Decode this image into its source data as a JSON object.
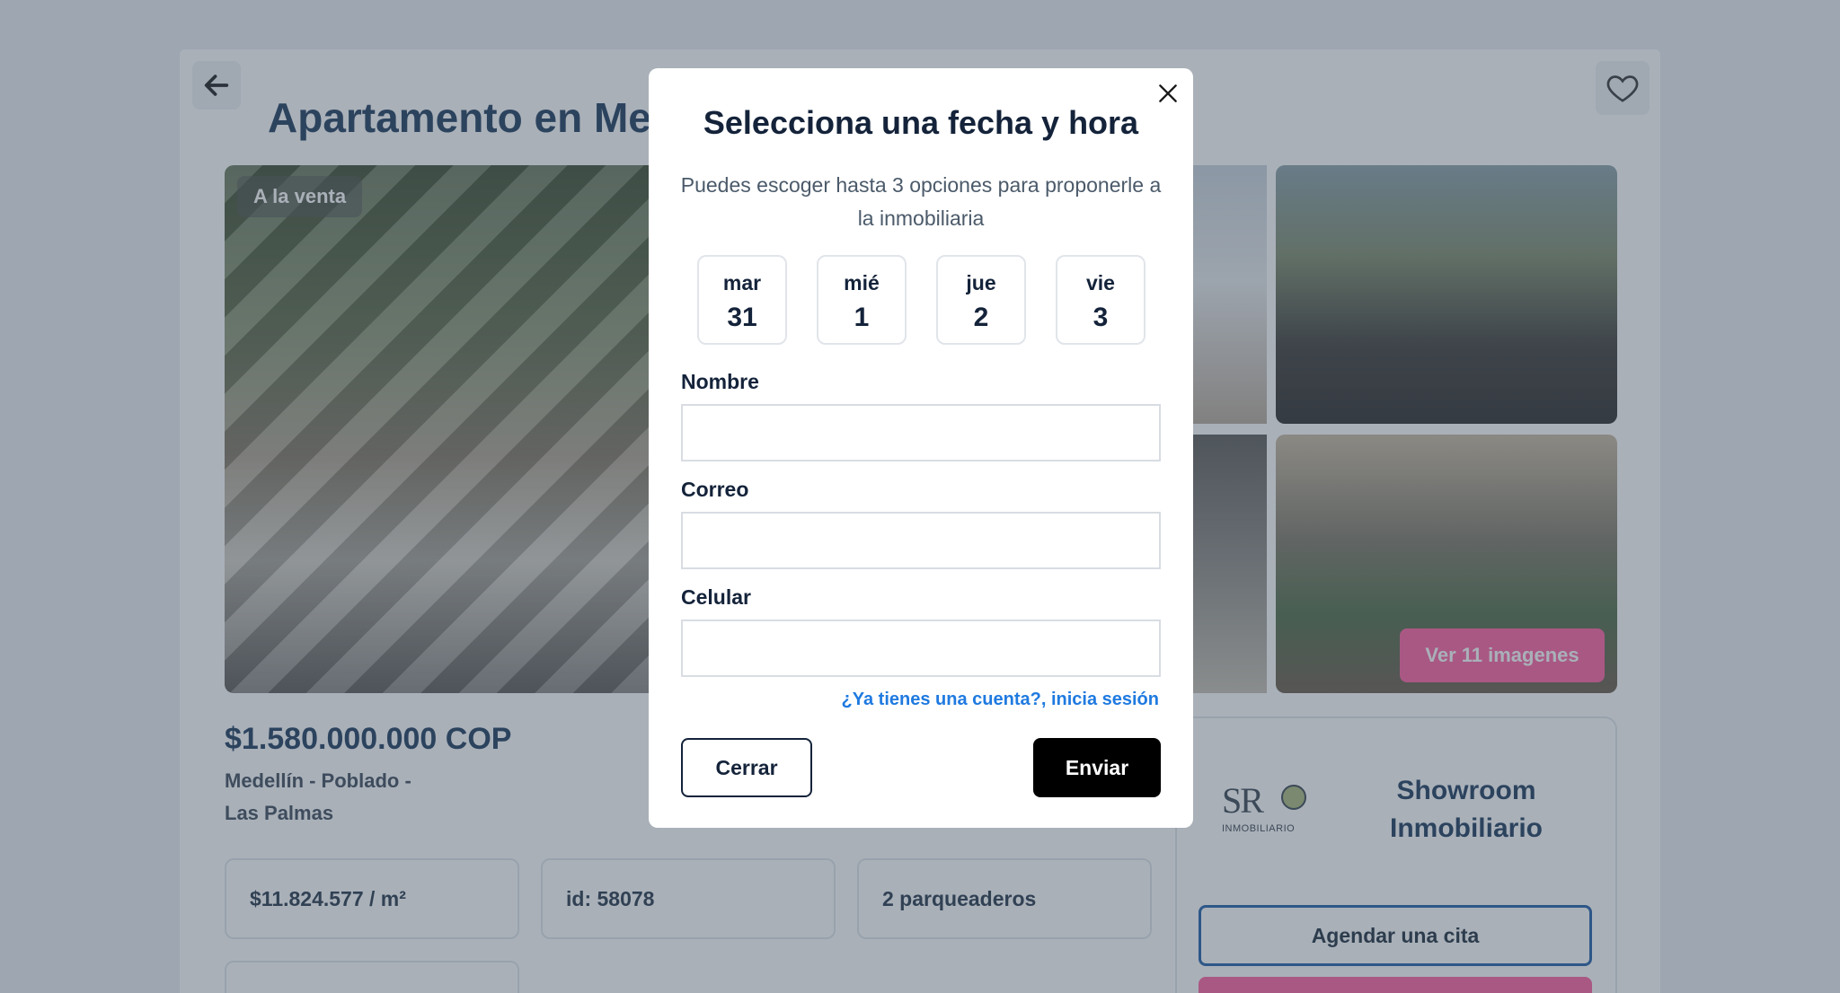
{
  "listing": {
    "title": "Apartamento en Medellín - Poblado a la venta",
    "badge": "A la venta",
    "gallery_button": "Ver 11 imagenes",
    "price": "$1.580.000.000 COP",
    "location_line1": "Medellín - Poblado -",
    "location_line2": "Las Palmas",
    "features": [
      "$11.824.577 / m²",
      "id: 58078",
      "2 parqueaderos",
      ""
    ]
  },
  "agent": {
    "logo_text": "SR",
    "logo_sub": "INMOBILIARIO",
    "name": "Showroom Inmobiliario",
    "schedule_button": "Agendar una cita"
  },
  "modal": {
    "title": "Selecciona una fecha y hora",
    "subtitle": "Puedes escoger hasta 3 opciones para proponerle a la inmobiliaria",
    "dates": [
      {
        "dow": "mar",
        "day": "31"
      },
      {
        "dow": "mié",
        "day": "1"
      },
      {
        "dow": "jue",
        "day": "2"
      },
      {
        "dow": "vie",
        "day": "3"
      }
    ],
    "fields": {
      "name_label": "Nombre",
      "email_label": "Correo",
      "phone_label": "Celular"
    },
    "login_link": "¿Ya tienes una cuenta?, inicia sesión",
    "close_button": "Cerrar",
    "send_button": "Enviar"
  },
  "icons": {
    "back": "arrow-left-icon",
    "favorite": "heart-icon",
    "close": "close-icon"
  },
  "colors": {
    "accent_pink": "#ff5fa0",
    "brand_blue": "#1f5ea8",
    "link_blue": "#1f7ae0",
    "send_black": "#000000"
  }
}
